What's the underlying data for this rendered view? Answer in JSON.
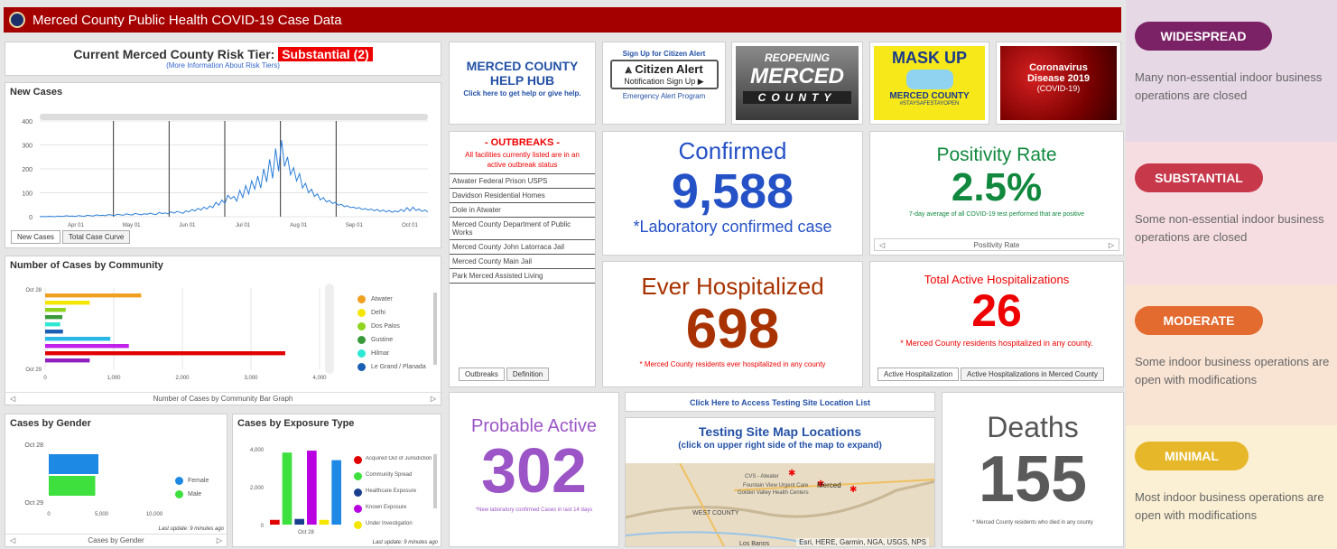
{
  "header": {
    "title": "Merced County Public Health COVID-19 Case Data"
  },
  "risk": {
    "label": "Current Merced County Risk Tier:",
    "tier": "Substantial (2)",
    "more": "(More Information About Risk Tiers)"
  },
  "new_cases": {
    "title": "New Cases",
    "tabs": [
      "New Cases",
      "Total Case Curve"
    ],
    "chart_data": {
      "type": "line",
      "ylim": [
        0,
        400
      ],
      "yticks": [
        "400",
        "300",
        "200",
        "100",
        "0"
      ],
      "xticks": [
        "Apr 01",
        "May 01",
        "Jun 01",
        "Jul 01",
        "Aug 01",
        "Sep 01",
        "Oct 01"
      ],
      "values": [
        0,
        1,
        0,
        2,
        1,
        0,
        3,
        1,
        2,
        4,
        2,
        3,
        1,
        5,
        3,
        2,
        6,
        4,
        3,
        8,
        5,
        6,
        4,
        9,
        7,
        5,
        10,
        8,
        6,
        12,
        9,
        7,
        14,
        10,
        8,
        12,
        10,
        15,
        11,
        9,
        18,
        13,
        16,
        12,
        20,
        15,
        22,
        18,
        14,
        25,
        20,
        30,
        24,
        35,
        28,
        40,
        32,
        45,
        38,
        60,
        48,
        70,
        55,
        90,
        75,
        85,
        65,
        110,
        80,
        130,
        95,
        150,
        115,
        170,
        120,
        200,
        145,
        240,
        160,
        285,
        190,
        320,
        210,
        250,
        175,
        205,
        150,
        180,
        120,
        140,
        100,
        115,
        85,
        95,
        70,
        80,
        62,
        68,
        55,
        60,
        48,
        52,
        42,
        46,
        38,
        40,
        35,
        38,
        30,
        34,
        28,
        32,
        25,
        30,
        22,
        28,
        20,
        26,
        18,
        24,
        20,
        30,
        22,
        38,
        24,
        40,
        26,
        32,
        22,
        28,
        20
      ]
    }
  },
  "community": {
    "title": "Number of Cases by Community",
    "footer": "Number of Cases by Community Bar Graph",
    "chart_data": {
      "type": "bar",
      "ytop": "Oct 28",
      "ybottom": "Oct 29",
      "xticks": [
        "0",
        "1,000",
        "2,000",
        "3,000",
        "4,000"
      ],
      "xlim": [
        0,
        4000
      ],
      "values": [
        1400,
        650,
        300,
        250,
        220,
        260,
        950,
        1220,
        3500,
        650
      ],
      "colors": [
        "#f0a020",
        "#f5e600",
        "#8fd420",
        "#3a9a3a",
        "#2ee8d4",
        "#1a5fb4",
        "#28b8e8",
        "#c020e8",
        "#e00000",
        "#9020c0"
      ]
    },
    "legend": [
      {
        "name": "Atwater",
        "color": "#f0a020"
      },
      {
        "name": "Delhi",
        "color": "#f5e600"
      },
      {
        "name": "Dos Palos",
        "color": "#8fd420"
      },
      {
        "name": "Gustine",
        "color": "#3a9a3a"
      },
      {
        "name": "Hilmar",
        "color": "#2ee8d4"
      },
      {
        "name": "Le Grand / Planada",
        "color": "#1a5fb4"
      }
    ]
  },
  "gender": {
    "title": "Cases by Gender",
    "footer": "Cases by Gender",
    "updated": "Last update: 9 minutes ago",
    "chart_data": {
      "type": "bar",
      "ytop": "Oct 28",
      "ybottom": "Oct 29",
      "xticks": [
        "0",
        "5,000",
        "10,000"
      ],
      "xlim": [
        0,
        10000
      ],
      "values": [
        4700,
        4400
      ],
      "colors": [
        "#1e88e5",
        "#3ee03e"
      ]
    },
    "legend": [
      {
        "name": "Female",
        "color": "#1e88e5"
      },
      {
        "name": "Male",
        "color": "#3ee03e"
      }
    ]
  },
  "exposure": {
    "title": "Cases by Exposure Type",
    "updated": "Last update: 9 minutes ago",
    "chart_data": {
      "type": "bar",
      "yticks": [
        "4,000",
        "2,000",
        "0"
      ],
      "ylim": [
        0,
        4000
      ],
      "xtick": "Oct 28",
      "values": [
        250,
        3800,
        300,
        3900,
        250,
        3400
      ],
      "colors": [
        "#e00000",
        "#3ee03e",
        "#1a3f8f",
        "#b800e0",
        "#f5e600",
        "#1e88e5"
      ]
    },
    "legend": [
      {
        "name": "Acquired Out of Jurisdiction",
        "color": "#e00000"
      },
      {
        "name": "Community Spread",
        "color": "#3ee03e"
      },
      {
        "name": "Healthcare Exposure",
        "color": "#1a3f8f"
      },
      {
        "name": "Known Exposure",
        "color": "#b800e0"
      },
      {
        "name": "Under Investigation",
        "color": "#f5e600"
      }
    ]
  },
  "helphub": {
    "title": "MERCED COUNTY HELP HUB",
    "sub": "Click here to get help or give help."
  },
  "citizen": {
    "top": "Sign Up for Citizen Alert",
    "name": "Citizen Alert",
    "btn": "Notification Sign Up ▶",
    "bottom": "Emergency Alert Program"
  },
  "reopening": {
    "line1": "REOPENING",
    "line2": "MERCED",
    "line3": "COUNTY"
  },
  "maskup": {
    "line1": "MASK UP",
    "line2": "MERCED COUNTY",
    "line3": "#STAYSAFESTAYOPEN"
  },
  "corona": {
    "line1": "Coronavirus",
    "line2": "Disease 2019",
    "line3": "(COVID-19)"
  },
  "outbreaks": {
    "title": "- OUTBREAKS -",
    "sub": "All facilities currently listed are in an active outbreak status",
    "items": [
      "Atwater Federal Prison USPS",
      "Davidson Residential Homes",
      "Dole in Atwater",
      "Merced County Department of Public Works",
      "Merced County John Latorraca Jail",
      "Merced County Main Jail",
      "Park Merced Assisted Living"
    ],
    "tabs": [
      "Outbreaks",
      "Definition"
    ]
  },
  "confirmed": {
    "title": "Confirmed",
    "value": "9,588",
    "sub": "*Laboratory confirmed case"
  },
  "positivity": {
    "title": "Positivity Rate",
    "value": "2.5%",
    "sub": "7-day average of all COVID-19 test performed that are positive",
    "footer": "Positivity Rate"
  },
  "hospitalized": {
    "title": "Ever Hospitalized",
    "value": "698",
    "sub": "* Merced County residents ever hospitalized in any county"
  },
  "active_hosp": {
    "title": "Total Active Hospitalizations",
    "value": "26",
    "sub": "* Merced County residents hospitalized in any county.",
    "tabs": [
      "Active Hospitalization",
      "Active Hospitalizations in Merced County"
    ]
  },
  "probable": {
    "title": "Probable Active",
    "value": "302",
    "sub": "*New laboratory confirmed Cases in last 14 days"
  },
  "testing": {
    "link": "Click Here to Access Testing Site Location List",
    "map_title": "Testing Site Map Locations",
    "map_sub": "(click on upper right side of the map to expand)",
    "attribution": "Esri, HERE, Garmin, NGA, USGS, NPS",
    "places": {
      "merced": "Merced",
      "cvs": "CVS - Atwater",
      "fv": "Fountain View Urgent Care",
      "gv": "Golden Valley Health Centers",
      "wc": "WEST COUNTY",
      "lb": "Los Banos"
    }
  },
  "deaths": {
    "title": "Deaths",
    "value": "155",
    "sub": "* Merced County residents who died in any county"
  },
  "tiers": [
    {
      "name": "WIDESPREAD",
      "desc": "Many non-essential indoor business operations are closed",
      "bg": "#e7d8e6",
      "btn": "#7b2266"
    },
    {
      "name": "SUBSTANTIAL",
      "desc": "Some non-essential indoor business operations are closed",
      "bg": "#f6dde2",
      "btn": "#c7384b"
    },
    {
      "name": "MODERATE",
      "desc": "Some indoor business operations are open with modifications",
      "bg": "#f9e4d4",
      "btn": "#e36b30"
    },
    {
      "name": "MINIMAL",
      "desc": "Most indoor business operations are open with modifications",
      "bg": "#fbf0d4",
      "btn": "#e7b72a"
    }
  ]
}
